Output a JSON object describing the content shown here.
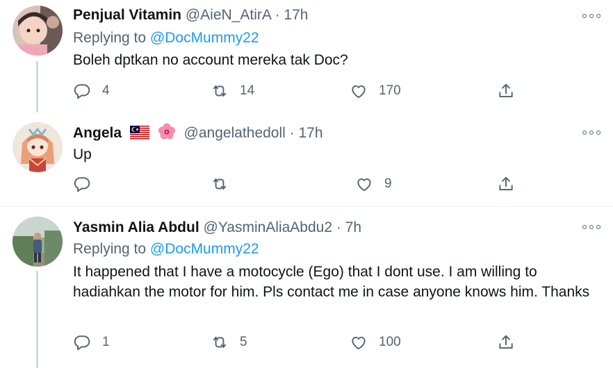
{
  "tweets": [
    {
      "name": "Penjual Vitamin",
      "handle": "@AieN_AtirA",
      "time": "· 17h",
      "replying_label": "Replying to",
      "replying_to": "@DocMummy22",
      "text": "Boleh dptkan no account mereka tak Doc?",
      "replies": "4",
      "retweets": "14",
      "likes": "170"
    },
    {
      "name": "Angela",
      "handle": "@angelathedoll",
      "time": "· 17h",
      "text": "Up",
      "replies": "",
      "retweets": "",
      "likes": "9",
      "emoji": [
        "flag-malaysia-icon",
        "hibiscus-icon"
      ]
    },
    {
      "name": "Yasmin Alia Abdul",
      "handle": "@YasminAliaAbdu2",
      "time": "· 7h",
      "replying_label": "Replying to",
      "replying_to": "@DocMummy22",
      "text": "It happened that I have a motocycle (Ego) that I dont use. I am willing to hadiahkan the motor for him. Pls contact me in case anyone knows him. Thanks",
      "replies": "1",
      "retweets": "5",
      "likes": "100"
    }
  ],
  "colors": {
    "accent": "#1d9bf0",
    "secondary": "#536471",
    "line": "#cfd9de"
  }
}
